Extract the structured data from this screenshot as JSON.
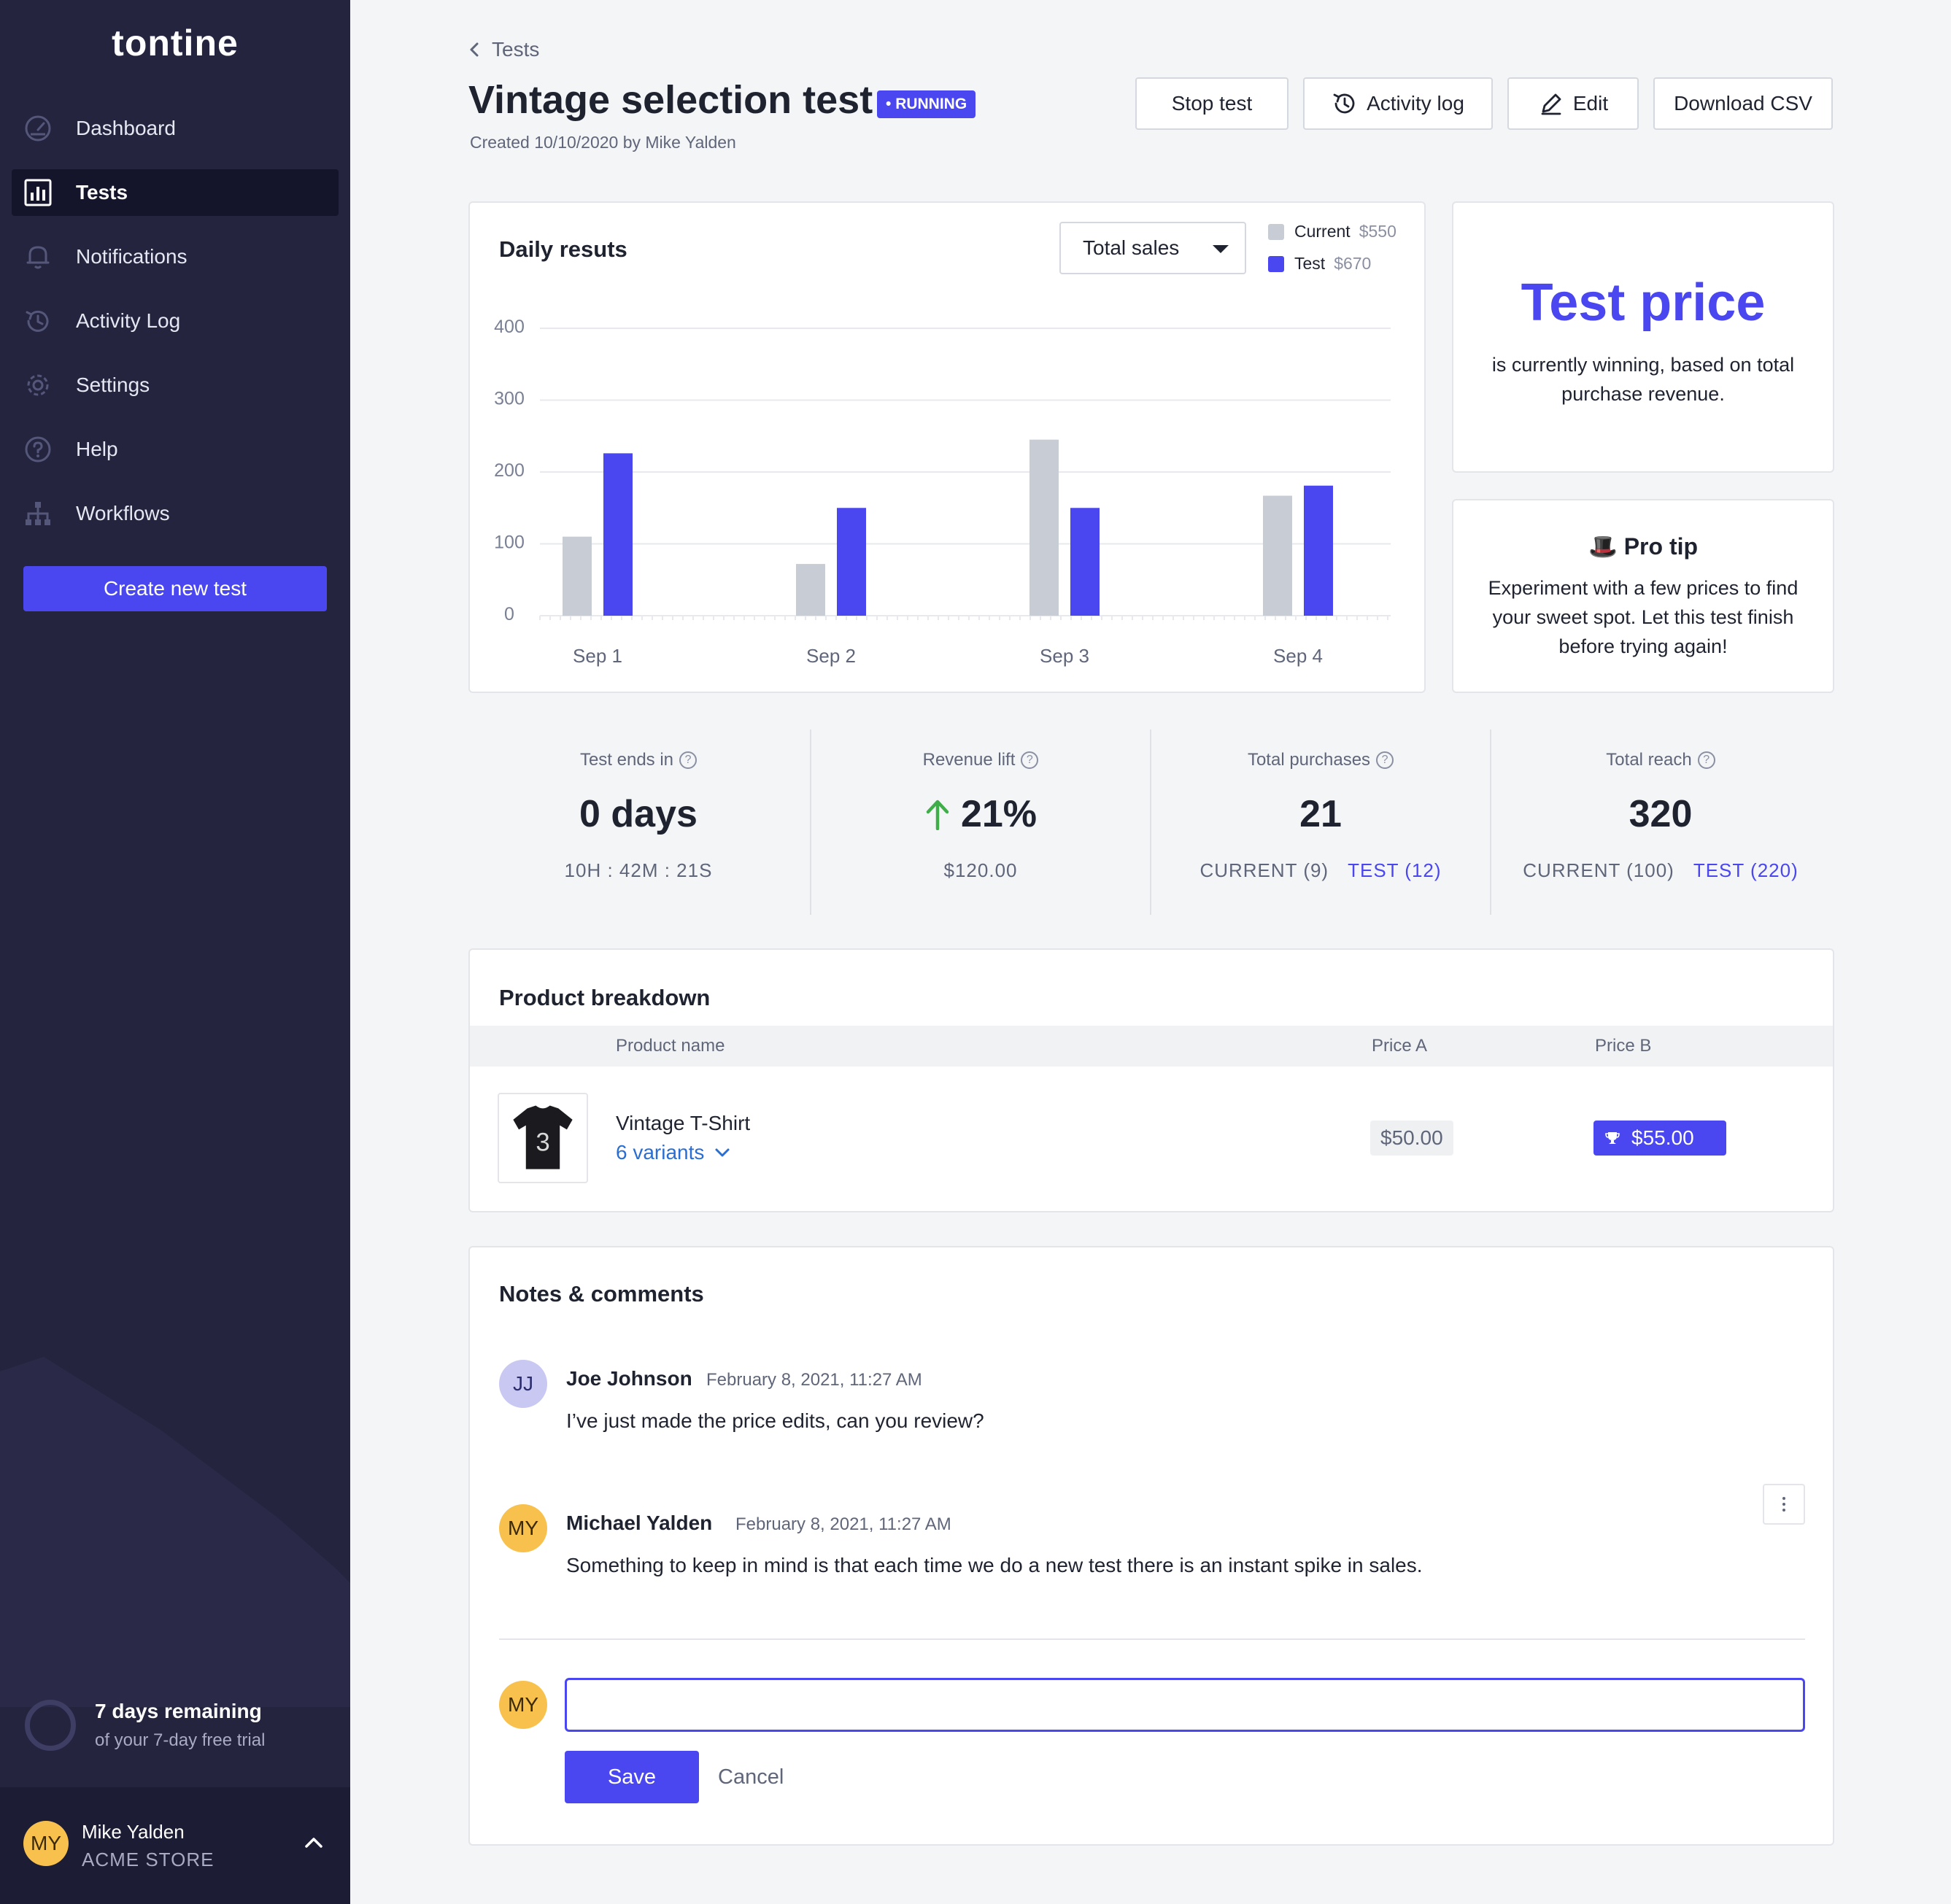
{
  "app": {
    "logo": "tontine"
  },
  "sidebar": {
    "items": [
      {
        "label": "Dashboard",
        "icon": "gauge-icon"
      },
      {
        "label": "Tests",
        "icon": "bar-chart-icon",
        "active": true
      },
      {
        "label": "Notifications",
        "icon": "bell-icon"
      },
      {
        "label": "Activity Log",
        "icon": "history-icon"
      },
      {
        "label": "Settings",
        "icon": "gear-icon"
      },
      {
        "label": "Help",
        "icon": "help-circle-icon"
      },
      {
        "label": "Workflows",
        "icon": "hierarchy-icon"
      }
    ],
    "create_label": "Create new test",
    "trial": {
      "title": "7 days remaining",
      "subtitle": "of your 7-day free trial"
    },
    "user": {
      "initials": "MY",
      "name": "Mike Yalden",
      "store": "ACME STORE"
    }
  },
  "header": {
    "back_label": "Tests",
    "title": "Vintage selection test",
    "status": "RUNNING",
    "created": "Created 10/10/2020 by Mike Yalden",
    "buttons": {
      "stop": "Stop test",
      "activity": "Activity log",
      "edit": "Edit",
      "download": "Download CSV"
    }
  },
  "daily": {
    "title": "Daily resuts",
    "metric": "Total sales",
    "legend": [
      {
        "label": "Current",
        "value": "$550"
      },
      {
        "label": "Test",
        "value": "$670"
      }
    ]
  },
  "chart_data": {
    "type": "bar",
    "categories": [
      "Sep 1",
      "Sep 2",
      "Sep 3",
      "Sep 4"
    ],
    "series": [
      {
        "name": "Current",
        "values": [
          110,
          72,
          245,
          167
        ]
      },
      {
        "name": "Test",
        "values": [
          226,
          150,
          150,
          181
        ]
      }
    ],
    "yticks": [
      400,
      300,
      200,
      100,
      0
    ],
    "ylim": [
      0,
      400
    ],
    "grid": true,
    "colors": {
      "Current": "#c8ccd5",
      "Test": "#4a46f0"
    }
  },
  "winner": {
    "title": "Test price",
    "text": "is currently winning, based on total purchase revenue."
  },
  "protip": {
    "emoji": "🎩",
    "title": "Pro tip",
    "text": "Experiment with a few prices to find your sweet spot. Let this test finish before trying again!"
  },
  "stats": [
    {
      "label": "Test ends in",
      "value": "0 days",
      "sub": "10H : 42M : 21S"
    },
    {
      "label": "Revenue lift",
      "value": "21%",
      "sub": "$120.00",
      "arrow": "up"
    },
    {
      "label": "Total purchases",
      "value": "21",
      "current": "CURRENT (9)",
      "test": "TEST (12)"
    },
    {
      "label": "Total reach",
      "value": "320",
      "current": "CURRENT (100)",
      "test": "TEST (220)"
    }
  ],
  "products": {
    "title": "Product breakdown",
    "columns": [
      "Product name",
      "Price A",
      "Price B"
    ],
    "rows": [
      {
        "name": "Vintage T-Shirt",
        "variants": "6 variants",
        "price_a": "$50.00",
        "price_b": "$55.00"
      }
    ]
  },
  "notes": {
    "title": "Notes & comments",
    "comments": [
      {
        "initials": "JJ",
        "author": "Joe Johnson",
        "time": "February 8, 2021, 11:27 AM",
        "text": "I’ve just made the price edits, can you review?"
      },
      {
        "initials": "MY",
        "author": "Michael Yalden",
        "time": "February 8, 2021, 11:27 AM",
        "text": "Something to keep in mind is that each time we do a new test there is an instant spike in sales."
      }
    ],
    "composer": {
      "initials": "MY",
      "value": "",
      "save": "Save",
      "cancel": "Cancel"
    }
  }
}
